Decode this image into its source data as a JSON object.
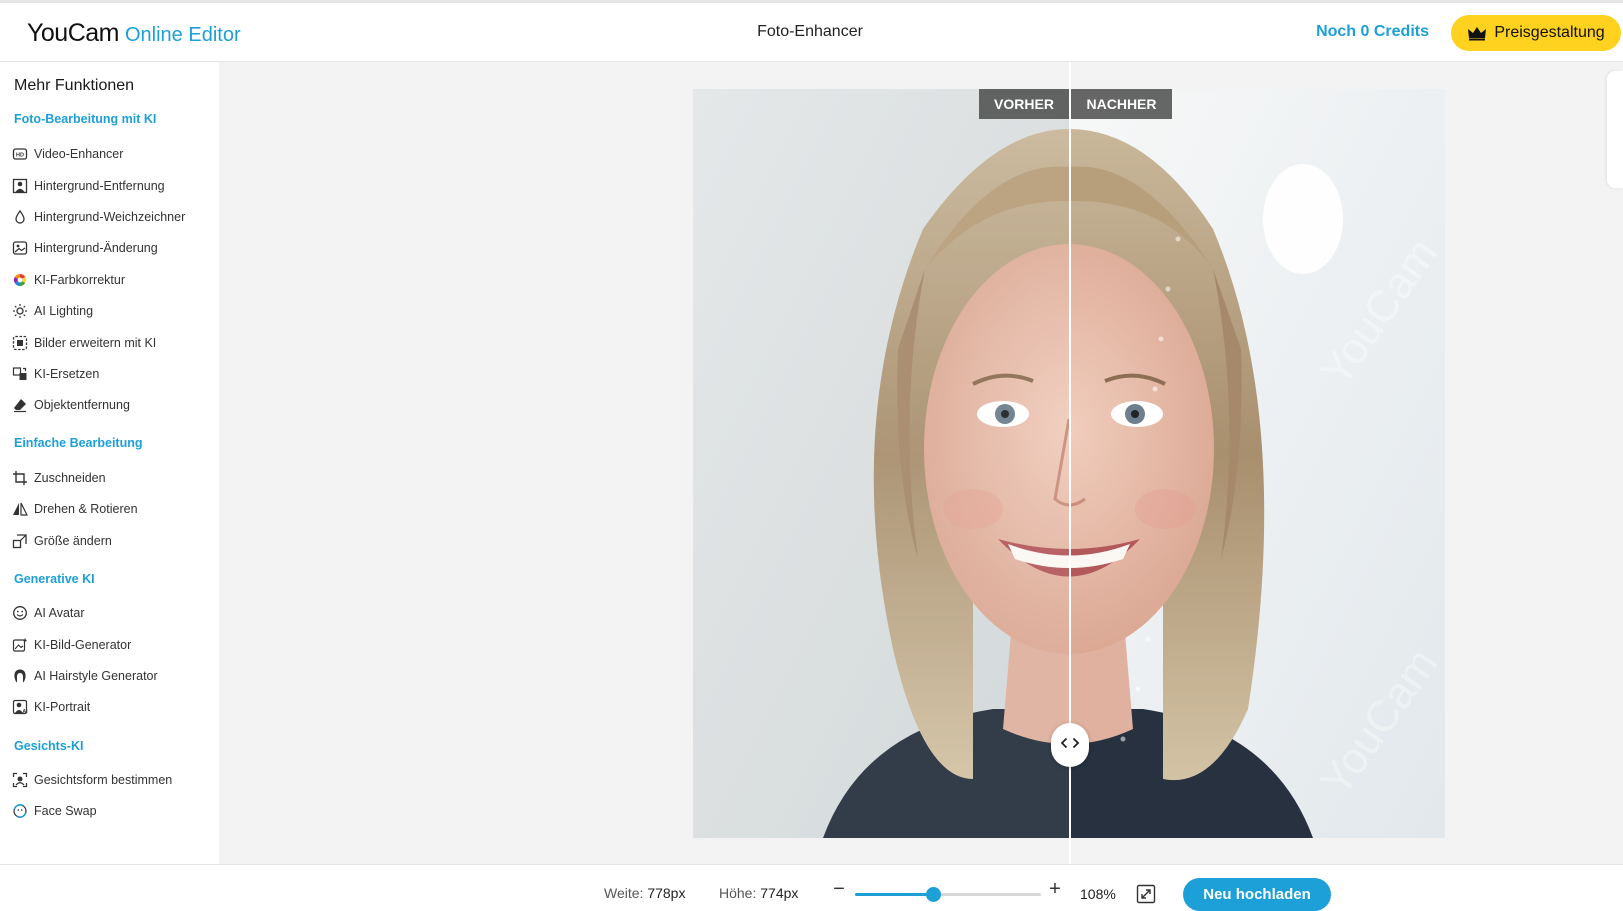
{
  "header": {
    "logo_brand": "YouCam",
    "logo_sub": "Online Editor",
    "title": "Foto-Enhancer",
    "credits": "Noch 0 Credits",
    "pricing_label": "Preisgestaltung"
  },
  "sidebar": {
    "title": "Mehr Funktionen",
    "sections": [
      {
        "label": "Foto-Bearbeitung mit KI",
        "items": [
          {
            "label": "Video-Enhancer",
            "icon": "video-hd-icon"
          },
          {
            "label": "Hintergrund-Entfernung",
            "icon": "background-remove-icon"
          },
          {
            "label": "Hintergrund-Weichzeichner",
            "icon": "droplet-icon"
          },
          {
            "label": "Hintergrund-Änderung",
            "icon": "image-change-icon"
          },
          {
            "label": "KI-Farbkorrektur",
            "icon": "color-wheel-icon"
          },
          {
            "label": "AI Lighting",
            "icon": "sun-icon"
          },
          {
            "label": "Bilder erweitern mit KI",
            "icon": "expand-image-icon"
          },
          {
            "label": "KI-Ersetzen",
            "icon": "replace-icon"
          },
          {
            "label": "Objektentfernung",
            "icon": "eraser-icon"
          }
        ]
      },
      {
        "label": "Einfache Bearbeitung",
        "items": [
          {
            "label": "Zuschneiden",
            "icon": "crop-icon"
          },
          {
            "label": "Drehen & Rotieren",
            "icon": "flip-icon"
          },
          {
            "label": "Größe ändern",
            "icon": "resize-icon"
          }
        ]
      },
      {
        "label": "Generative KI",
        "items": [
          {
            "label": "AI Avatar",
            "icon": "smiley-icon"
          },
          {
            "label": "KI-Bild-Generator",
            "icon": "image-generator-icon"
          },
          {
            "label": "AI Hairstyle Generator",
            "icon": "hairstyle-icon"
          },
          {
            "label": "KI-Portrait",
            "icon": "portrait-icon"
          }
        ]
      },
      {
        "label": "Gesichts-KI",
        "items": [
          {
            "label": "Gesichtsform bestimmen",
            "icon": "face-scan-icon"
          },
          {
            "label": "Face Swap",
            "icon": "face-swap-icon"
          }
        ]
      }
    ]
  },
  "compare": {
    "before_label": "VORHER",
    "after_label": "NACHHER"
  },
  "bottom": {
    "width_label": "Weite:",
    "width_value": "778px",
    "height_label": "Höhe:",
    "height_value": "774px",
    "zoom_percent": 108,
    "zoom_fraction": 0.42,
    "zoom_label": "108%",
    "upload_label": "Neu hochladen"
  },
  "colors": {
    "accent": "#1d9fd8",
    "pricing_bg": "#ffd21f"
  }
}
